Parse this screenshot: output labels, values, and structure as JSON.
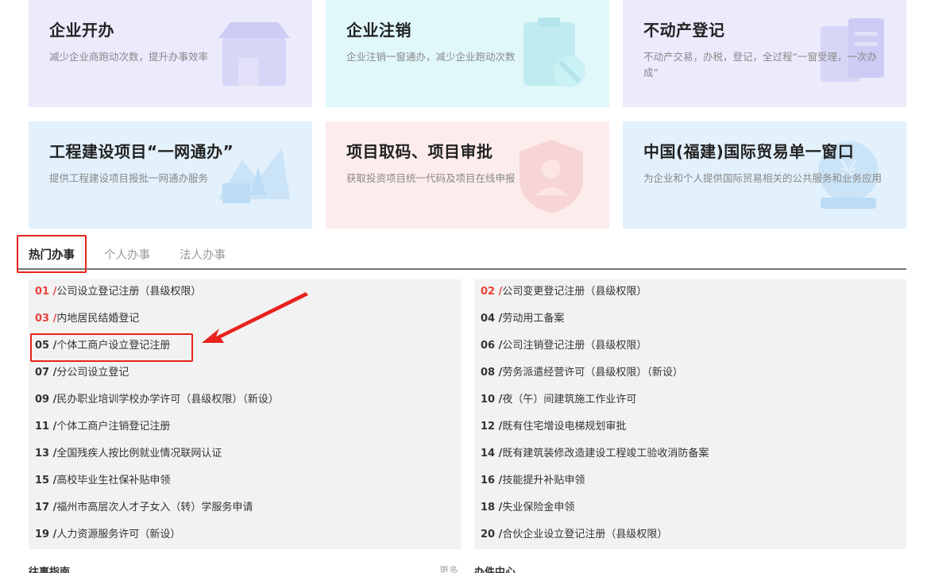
{
  "cards": [
    {
      "title": "企业开办",
      "desc": "减少企业商跑动次数，提升办事效率",
      "bg": "#ecebfc",
      "icon": "shop-icon"
    },
    {
      "title": "企业注销",
      "desc": "企业注销一窗通办，减少企业跑动次数",
      "bg": "#e1f8fb",
      "icon": "clipboard-cancel-icon"
    },
    {
      "title": "不动产登记",
      "desc": "不动产交易，办税，登记，全过程“一窗受理，一次办成”",
      "bg": "#ecebfc",
      "icon": "property-document-icon"
    },
    {
      "title": "工程建设项目“一网通办”",
      "desc": "提供工程建设项目报批一网通办服务",
      "bg": "#e3f1fc",
      "icon": "excavator-icon"
    },
    {
      "title": "项目取码、项目审批",
      "desc": "获取投资项目统一代码及项目在线申报",
      "bg": "#fdecec",
      "icon": "shield-person-icon"
    },
    {
      "title": "中国(福建)国际贸易单一窗口",
      "desc": "为企业和个人提供国际贸易相关的公共服务和业务应用",
      "bg": "#e3f1fc",
      "icon": "yuan-globe-icon"
    }
  ],
  "tabs": [
    {
      "label": "热门办事",
      "active": true
    },
    {
      "label": "个人办事",
      "active": false
    },
    {
      "label": "法人办事",
      "active": false
    }
  ],
  "left_items": [
    {
      "num": "01 /",
      "text": "公司设立登记注册（县级权限）",
      "red": true
    },
    {
      "num": "03 /",
      "text": "内地居民结婚登记",
      "red": true
    },
    {
      "num": "05 /",
      "text": "个体工商户设立登记注册",
      "red": false
    },
    {
      "num": "07 /",
      "text": "分公司设立登记",
      "red": false
    },
    {
      "num": "09 /",
      "text": "民办职业培训学校办学许可（县级权限）（新设）",
      "red": false
    },
    {
      "num": "11 /",
      "text": "个体工商户注销登记注册",
      "red": false
    },
    {
      "num": "13 /",
      "text": "全国残疾人按比例就业情况联网认证",
      "red": false
    },
    {
      "num": "15 /",
      "text": "高校毕业生社保补贴申领",
      "red": false
    },
    {
      "num": "17 /",
      "text": "福州市高层次人才子女入（转）学服务申请",
      "red": false
    },
    {
      "num": "19 /",
      "text": "人力资源服务许可（新设）",
      "red": false
    }
  ],
  "right_items": [
    {
      "num": "02 /",
      "text": "公司变更登记注册（县级权限）",
      "red": true
    },
    {
      "num": "04 /",
      "text": "劳动用工备案",
      "red": false
    },
    {
      "num": "06 /",
      "text": "公司注销登记注册（县级权限）",
      "red": false
    },
    {
      "num": "08 /",
      "text": "劳务派遣经营许可（县级权限）（新设）",
      "red": false
    },
    {
      "num": "10 /",
      "text": "夜（午）间建筑施工作业许可",
      "red": false
    },
    {
      "num": "12 /",
      "text": "既有住宅增设电梯规划审批",
      "red": false
    },
    {
      "num": "14 /",
      "text": "既有建筑装修改造建设工程竣工验收消防备案",
      "red": false
    },
    {
      "num": "16 /",
      "text": "技能提升补贴申领",
      "red": false
    },
    {
      "num": "18 /",
      "text": "失业保险金申领",
      "red": false
    },
    {
      "num": "20 /",
      "text": "合伙企业设立登记注册（县级权限）",
      "red": false
    }
  ],
  "bottom": {
    "left": "往事指南",
    "mid": "更多",
    "right": "办件中心"
  },
  "colors": {
    "highlight": "#e8231d",
    "red_num": "#e8413c"
  }
}
